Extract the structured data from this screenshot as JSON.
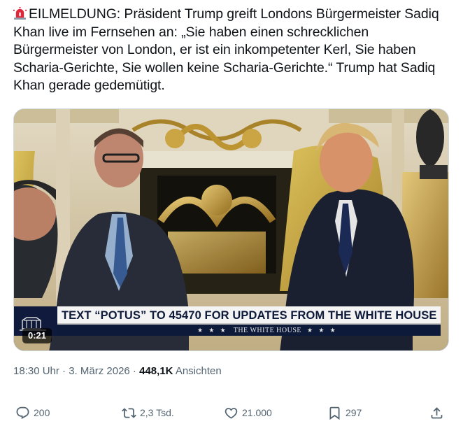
{
  "tweet": {
    "alarm_icon": "rotating-light-emoji",
    "text": "EILMELDUNG: Präsident Trump greift Londons Bürgermeister Sadiq Khan live im Fernsehen an: „Sie haben einen schrecklichen Bürgermeister von London, er ist ein inkompetenter Kerl, Sie haben Scharia-Gerichte, Sie wollen keine Scharia-Gerichte.“ Trump hat Sadiq Khan gerade gedemütigt."
  },
  "video": {
    "lower_third_main": "TEXT “POTUS” TO 45470 FOR UPDATES FROM THE WHITE HOUSE",
    "lower_third_stars_left": "★ ★ ★",
    "lower_third_sub": "THE WHITE HOUSE",
    "lower_third_stars_right": "★ ★ ★",
    "duration": "0:21"
  },
  "meta": {
    "time": "18:30 Uhr",
    "separator": " · ",
    "date": "3. März 2026",
    "separator2": " · ",
    "views_count": "448,1K",
    "views_label": " Ansichten"
  },
  "actions": {
    "replies": "200",
    "reposts": "2,3 Tsd.",
    "likes": "21.000",
    "bookmarks": "297"
  },
  "colors": {
    "text": "#0f1419",
    "secondary": "#536471",
    "lower_third_navy": "#0e1a3a"
  }
}
